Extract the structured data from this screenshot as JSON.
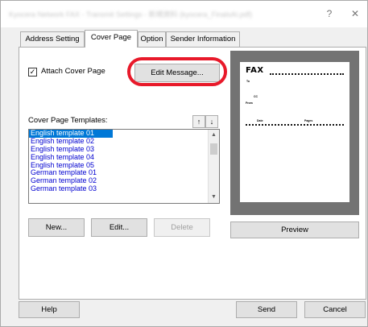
{
  "window": {
    "title": "Kyocera Network FAX - Transmit Settings - 新規資料 (kyocera_FinalsAI.pdf)",
    "help_button": "?",
    "close_button": "✕"
  },
  "tabs": [
    {
      "label": "Address Setting"
    },
    {
      "label": "Cover Page"
    },
    {
      "label": "Option"
    },
    {
      "label": "Sender Information"
    }
  ],
  "cover_page": {
    "attach_checkbox": {
      "checked": true,
      "mark": "✓",
      "label": "Attach Cover Page"
    },
    "edit_message_button": "Edit Message...",
    "templates_label": "Cover Page Templates:",
    "move_up_button": "↑",
    "move_down_button": "↓",
    "templates": [
      "English template 01",
      "English template 02",
      "English template 03",
      "English template 04",
      "English template 05",
      "German template 01",
      "German template 02",
      "German template 03"
    ],
    "selected_template": "English template 01",
    "scroll_up": "▲",
    "scroll_down": "▼",
    "new_button": "New...",
    "edit_button": "Edit...",
    "delete_button": "Delete",
    "preview": {
      "fax_title": "FAX",
      "to_label": "To",
      "cc_label": "CC",
      "from_label": "From",
      "date_label": "Date",
      "pages_label": "Pages"
    },
    "preview_button": "Preview"
  },
  "footer": {
    "help_button": "Help",
    "send_button": "Send",
    "cancel_button": "Cancel"
  },
  "colors": {
    "highlight": "#e8192a",
    "selection": "#0078d7",
    "list_text": "#0000d0"
  }
}
